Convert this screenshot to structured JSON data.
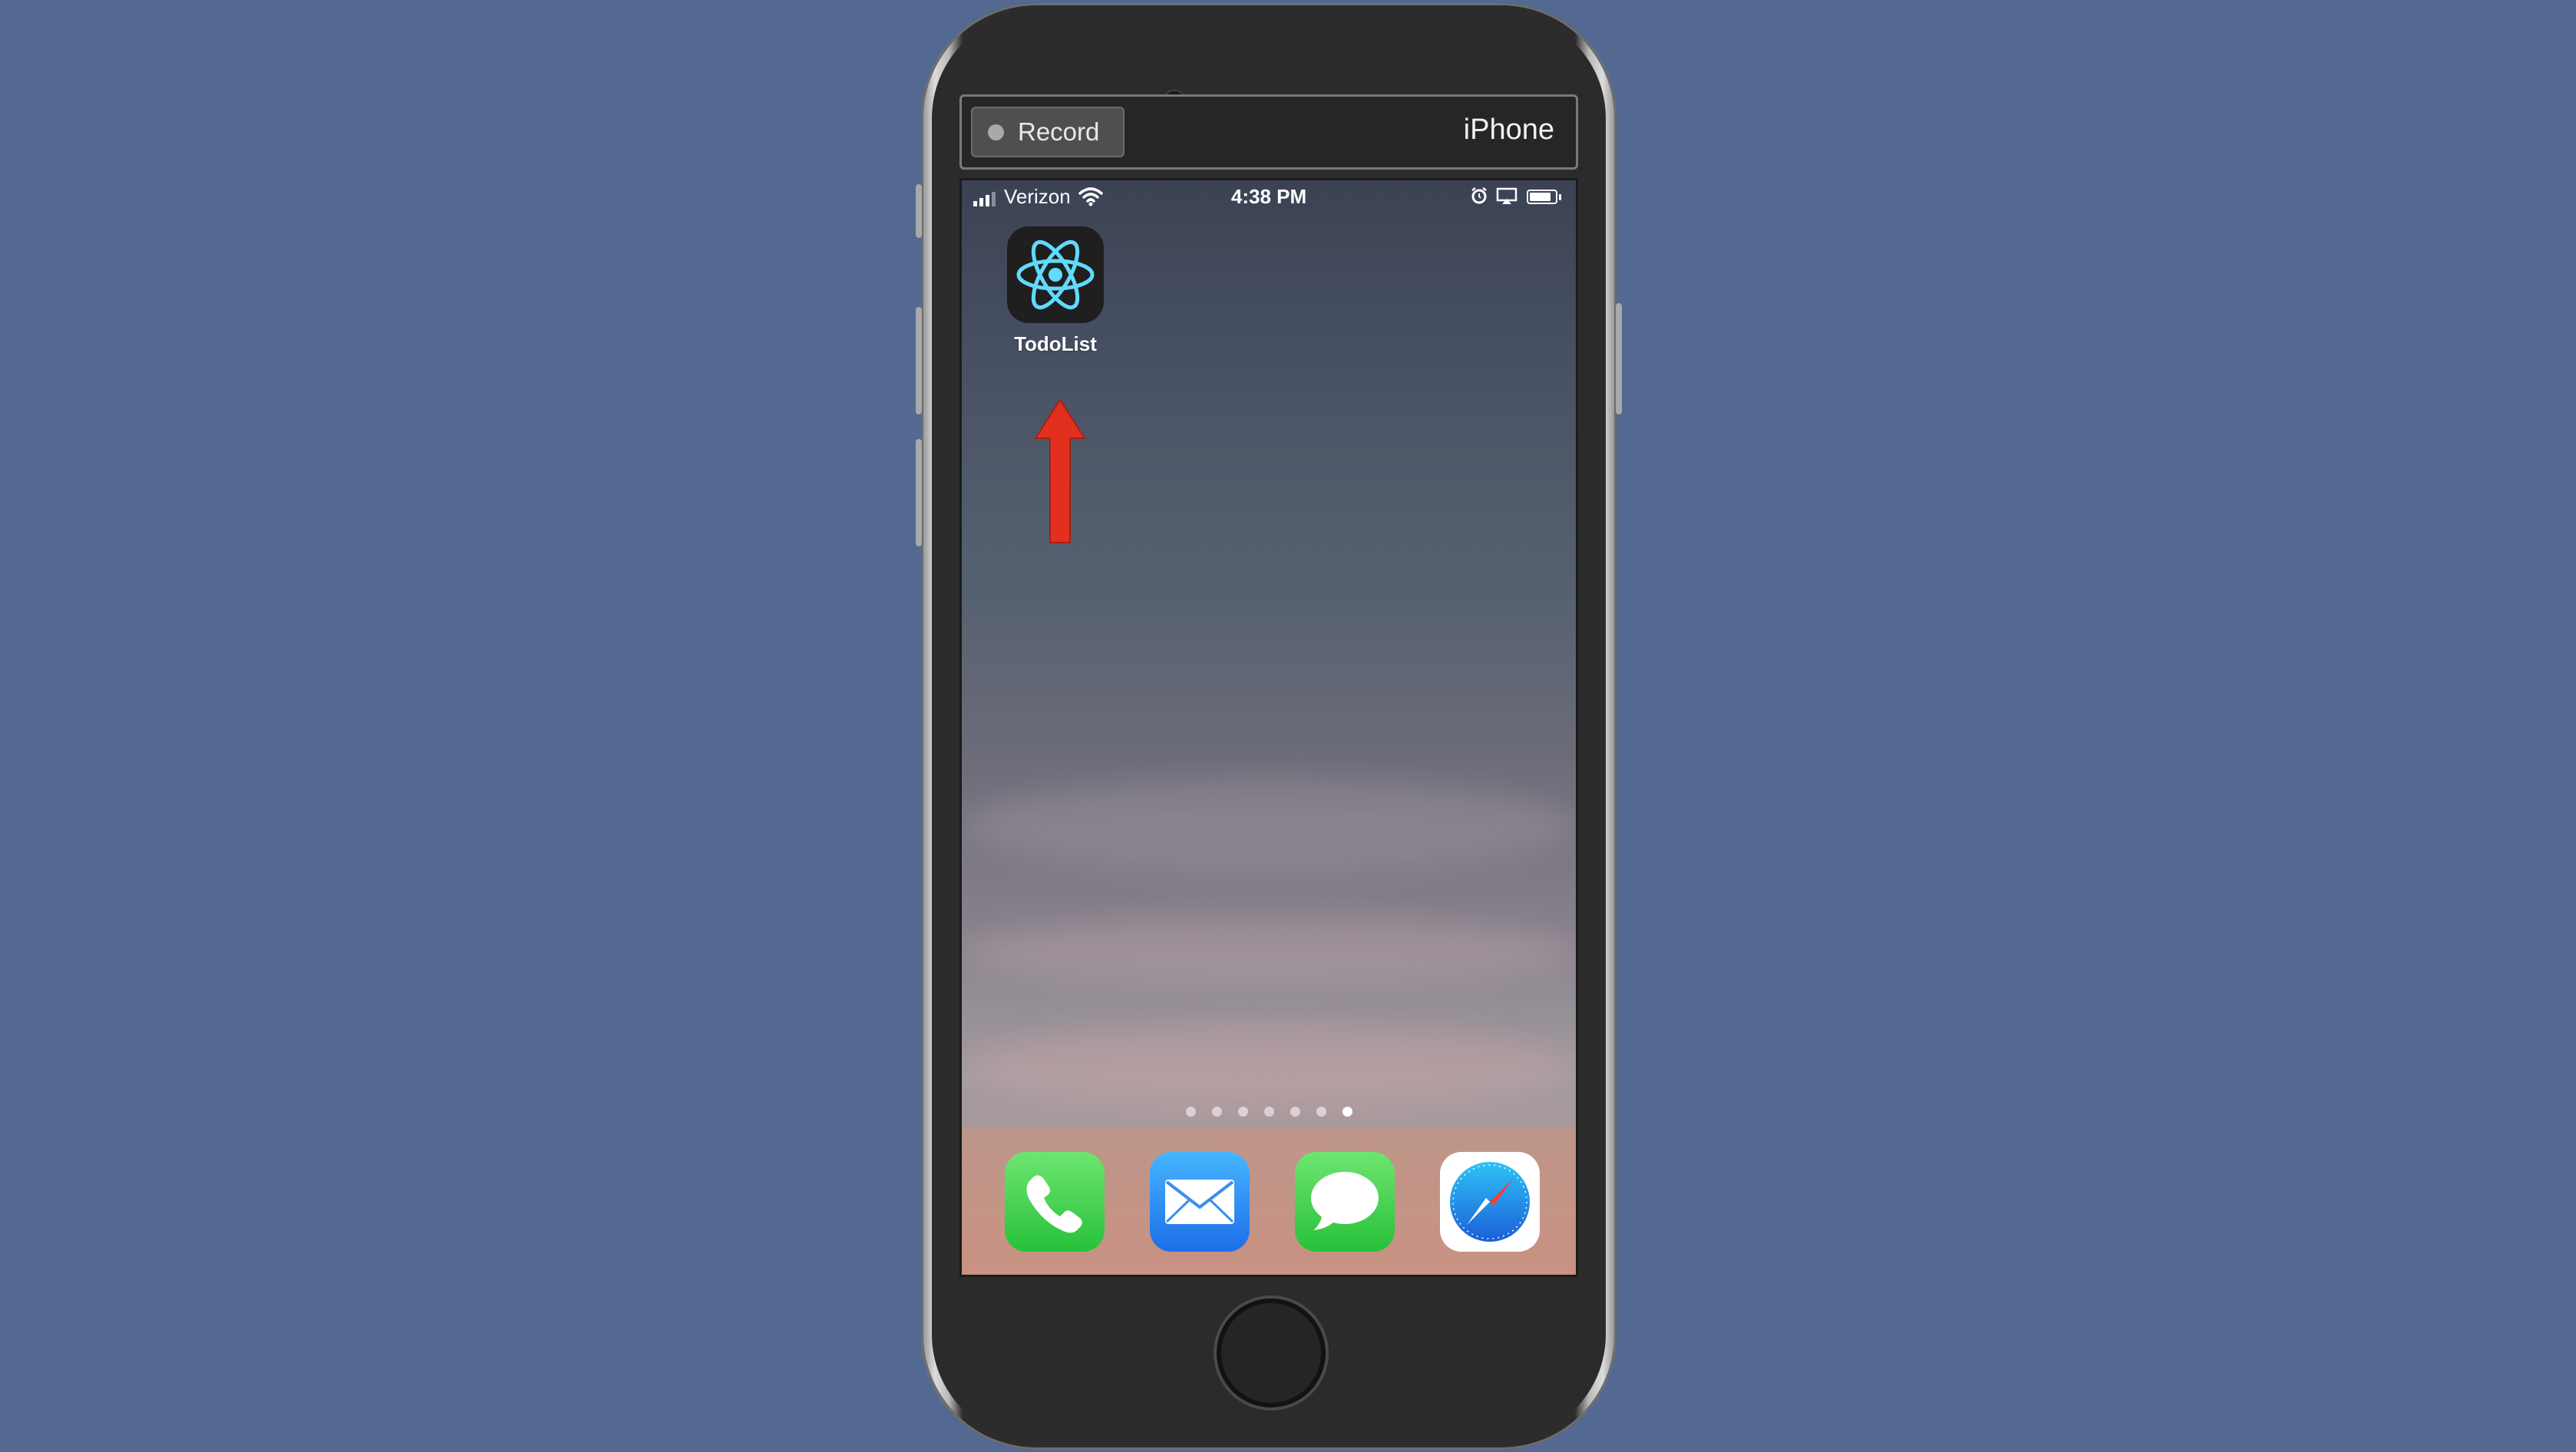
{
  "toolbar": {
    "record_label": "Record",
    "device_name": "iPhone"
  },
  "status_bar": {
    "carrier": "Verizon",
    "time": "4:38 PM",
    "battery_level": 0.85
  },
  "home_screen": {
    "apps": [
      {
        "label": "TodoList",
        "icon": "react-atom-icon"
      }
    ],
    "page_count": 7,
    "current_page": 7,
    "annotation_arrow_color": "#e3301e"
  },
  "dock": {
    "apps": [
      {
        "name": "Phone",
        "icon": "phone-icon",
        "color": "#4cd964"
      },
      {
        "name": "Mail",
        "icon": "mail-icon",
        "color": "#2f86f1"
      },
      {
        "name": "Messages",
        "icon": "messages-icon",
        "color": "#4cd964"
      },
      {
        "name": "Safari",
        "icon": "safari-icon",
        "color": "#1e88e5"
      }
    ]
  },
  "colors": {
    "background": "#536991",
    "react_blue": "#61dafb"
  }
}
